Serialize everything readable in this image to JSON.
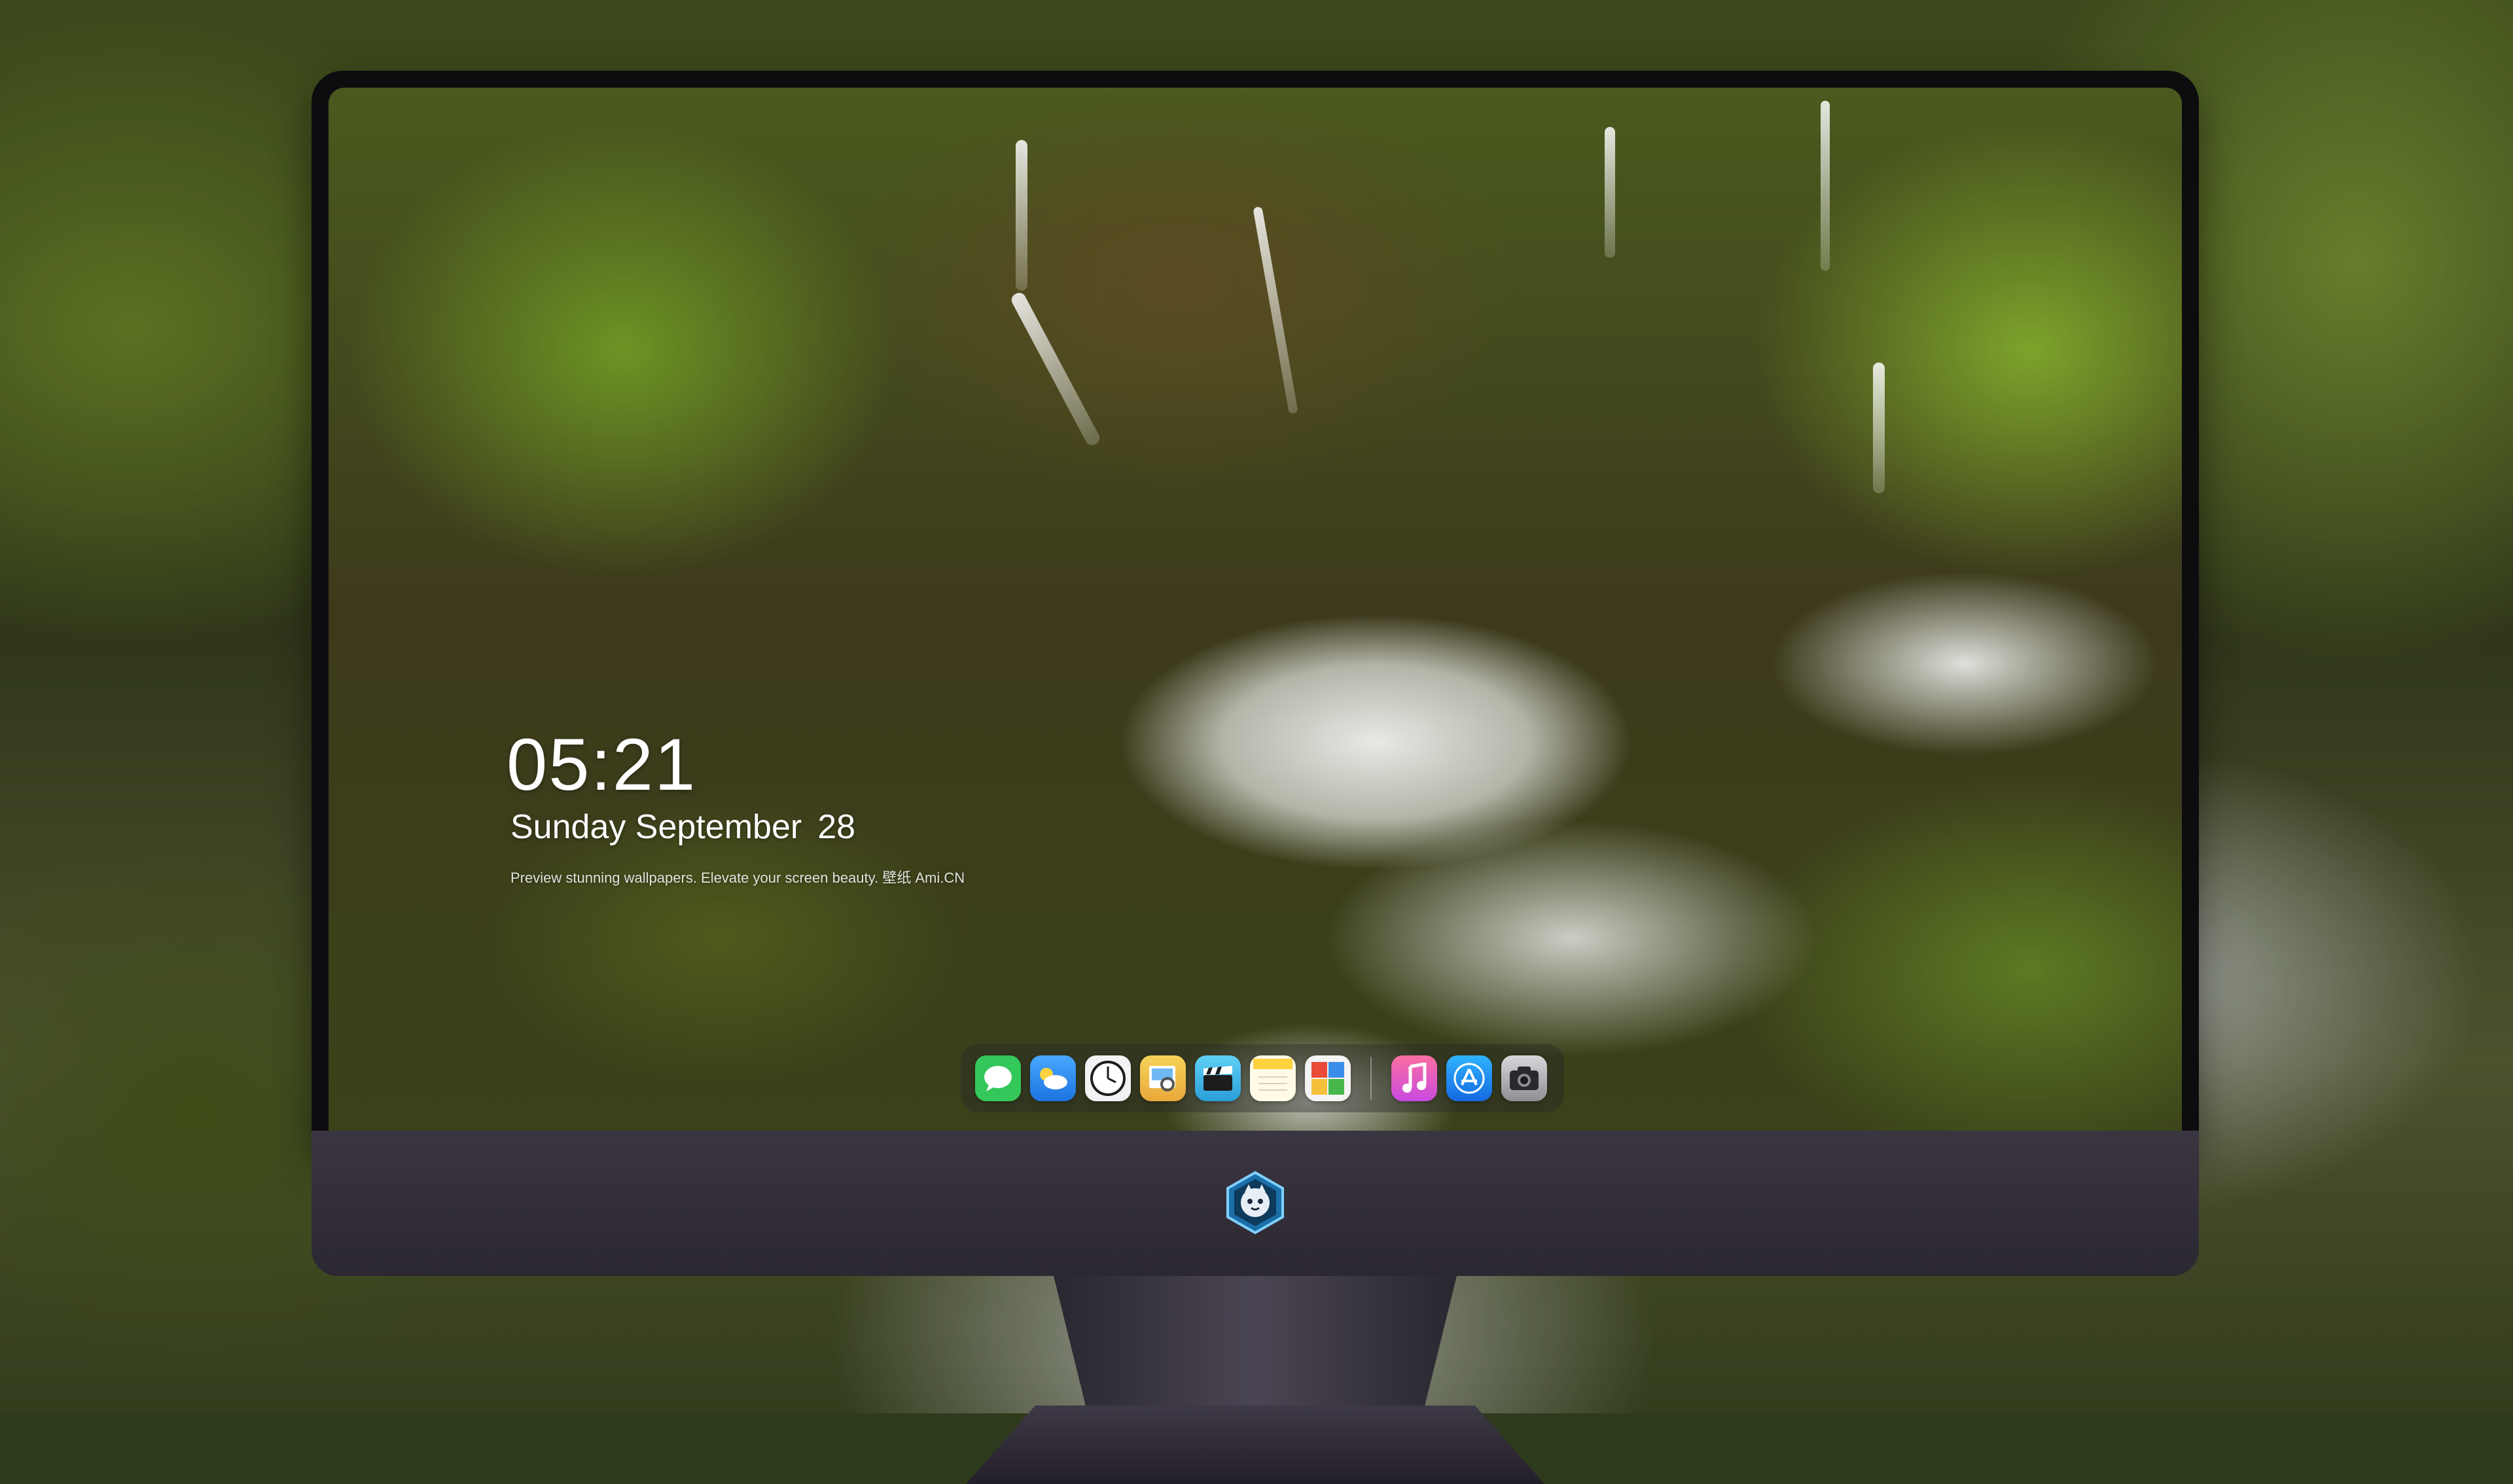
{
  "lock_screen": {
    "time": "05:21",
    "weekday_month": "Sunday September",
    "day": "28",
    "tagline": "Preview stunning wallpapers. Elevate your screen beauty. 壁纸 Ami.CN"
  },
  "dock": {
    "apps": [
      {
        "name": "Messages",
        "icon": "messages-icon",
        "color": "#34c759"
      },
      {
        "name": "Weather",
        "icon": "weather-icon",
        "color": "#2f8ff0"
      },
      {
        "name": "Clock",
        "icon": "clock-icon",
        "color": "#1c1c1e"
      },
      {
        "name": "Preview",
        "icon": "preview-icon",
        "color": "#f0c842"
      },
      {
        "name": "Clips",
        "icon": "clapperboard-icon",
        "color": "#3fb8e8"
      },
      {
        "name": "Notes",
        "icon": "notes-icon",
        "color": "#ffd23f"
      },
      {
        "name": "Photo Booth",
        "icon": "photo-grid-icon",
        "color": "#e94a3a"
      },
      {
        "name": "Music",
        "icon": "music-icon",
        "color": "#f55d8b"
      },
      {
        "name": "App Store",
        "icon": "app-store-icon",
        "color": "#1d8bf5"
      },
      {
        "name": "Camera",
        "icon": "camera-icon",
        "color": "#5a5a5e"
      }
    ]
  },
  "monitor": {
    "chin_color": "#312c37",
    "logo": "mascot-logo-icon"
  }
}
